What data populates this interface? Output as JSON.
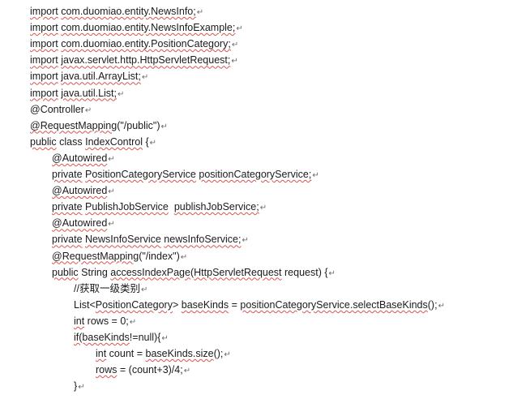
{
  "document": {
    "paragraph_mark": "↵",
    "lines": [
      {
        "indent": 0,
        "segments": [
          {
            "t": "import",
            "sq": true
          },
          {
            "t": " "
          },
          {
            "t": "com.duomiao.entity.NewsInfo;",
            "sq": true
          }
        ]
      },
      {
        "indent": 0,
        "segments": [
          {
            "t": "import",
            "sq": true
          },
          {
            "t": " "
          },
          {
            "t": "com.duomiao.entity.NewsInfoExample;",
            "sq": true
          }
        ]
      },
      {
        "indent": 0,
        "segments": [
          {
            "t": "import",
            "sq": true
          },
          {
            "t": " "
          },
          {
            "t": "com.duomiao.entity.PositionCategory;",
            "sq": true
          }
        ]
      },
      {
        "indent": 0,
        "segments": [
          {
            "t": "import",
            "sq": true
          },
          {
            "t": " "
          },
          {
            "t": "javax.servlet.http.HttpServletRequest;",
            "sq": true
          }
        ]
      },
      {
        "indent": 0,
        "segments": [
          {
            "t": "import",
            "sq": true
          },
          {
            "t": " "
          },
          {
            "t": "java.util.ArrayList;",
            "sq": true
          }
        ]
      },
      {
        "indent": 0,
        "segments": [
          {
            "t": "import",
            "sq": true
          },
          {
            "t": " "
          },
          {
            "t": "java.util.List;",
            "sq": true
          }
        ]
      },
      {
        "indent": 0,
        "segments": [
          {
            "t": "@Controller"
          }
        ]
      },
      {
        "indent": 0,
        "segments": [
          {
            "t": "@RequestMapping",
            "sq": true
          },
          {
            "t": "(\"/public\")"
          }
        ]
      },
      {
        "indent": 0,
        "segments": [
          {
            "t": "public",
            "sq": true
          },
          {
            "t": " class "
          },
          {
            "t": "IndexControl",
            "sq": true
          },
          {
            "t": " {"
          }
        ]
      },
      {
        "indent": 1,
        "segments": [
          {
            "t": "@Autowired",
            "sq": true
          }
        ]
      },
      {
        "indent": 1,
        "segments": [
          {
            "t": "private",
            "sq": true
          },
          {
            "t": " "
          },
          {
            "t": "PositionCategoryService",
            "sq": true
          },
          {
            "t": " "
          },
          {
            "t": "positionCategoryService;",
            "sq": true
          }
        ]
      },
      {
        "indent": 1,
        "segments": [
          {
            "t": "@Autowired",
            "sq": true
          }
        ]
      },
      {
        "indent": 1,
        "segments": [
          {
            "t": "private",
            "sq": true
          },
          {
            "t": " "
          },
          {
            "t": "PublishJobService",
            "sq": true
          },
          {
            "t": "  "
          },
          {
            "t": "publishJobService;",
            "sq": true
          }
        ]
      },
      {
        "indent": 1,
        "segments": [
          {
            "t": "@Autowired",
            "sq": true
          }
        ]
      },
      {
        "indent": 1,
        "segments": [
          {
            "t": "private",
            "sq": true
          },
          {
            "t": " "
          },
          {
            "t": "NewsInfoService",
            "sq": true
          },
          {
            "t": " "
          },
          {
            "t": "newsInfoService;",
            "sq": true
          }
        ]
      },
      {
        "indent": 1,
        "segments": [
          {
            "t": "@RequestMapping",
            "sq": true
          },
          {
            "t": "(\"/index\")"
          }
        ]
      },
      {
        "indent": 1,
        "segments": [
          {
            "t": "public",
            "sq": true
          },
          {
            "t": " String "
          },
          {
            "t": "accessIndexPage",
            "sq": true
          },
          {
            "t": "("
          },
          {
            "t": "HttpServletRequest",
            "sq": true
          },
          {
            "t": " request) {"
          }
        ]
      },
      {
        "indent": 2,
        "segments": [
          {
            "t": "//获取一级类别"
          }
        ]
      },
      {
        "indent": 2,
        "segments": [
          {
            "t": "List<"
          },
          {
            "t": "PositionCategory",
            "sq": true
          },
          {
            "t": "> "
          },
          {
            "t": "baseKinds",
            "sq": true
          },
          {
            "t": " = "
          },
          {
            "t": "positionCategoryService.selectBaseKinds",
            "sq": true
          },
          {
            "t": "();"
          }
        ]
      },
      {
        "indent": 2,
        "segments": [
          {
            "t": "int",
            "sq": true
          },
          {
            "t": " rows = 0;"
          }
        ]
      },
      {
        "indent": 2,
        "segments": [
          {
            "t": "if(baseKinds",
            "sq": true
          },
          {
            "t": "!=null){"
          }
        ]
      },
      {
        "indent": 3,
        "segments": [
          {
            "t": "int",
            "sq": true
          },
          {
            "t": " count = "
          },
          {
            "t": "baseKinds.size",
            "sq": true
          },
          {
            "t": "();"
          }
        ]
      },
      {
        "indent": 3,
        "segments": [
          {
            "t": "rows",
            "sq": true
          },
          {
            "t": " = (count+3)/4;"
          }
        ]
      },
      {
        "indent": 2,
        "segments": [
          {
            "t": "}"
          }
        ]
      }
    ]
  }
}
